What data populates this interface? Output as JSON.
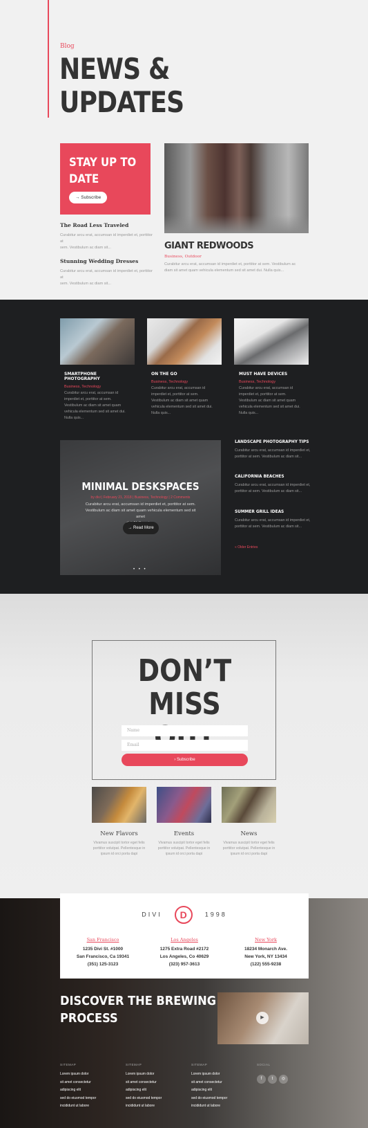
{
  "header": {
    "kicker": "Blog",
    "title_line1": "NEWS &",
    "title_line2": "UPDATES"
  },
  "subscribe_box": {
    "title_line1": "STAY UP TO",
    "title_line2": "DATE",
    "button": "→ Subscribe"
  },
  "posts_left": [
    {
      "title": "The Road Less Traveled",
      "excerpt1": "Curabitur arcu erat, accumsan id imperdiet et, porttitor at",
      "excerpt2": "sem. Vestibulum ac diam sit..."
    },
    {
      "title": "Stunning Wedding Dresses",
      "excerpt1": "Curabitur arcu erat, accumsan id imperdiet et, porttitor at",
      "excerpt2": "sem. Vestibulum ac diam sit..."
    }
  ],
  "featured": {
    "title": "GIANT REDWOODS",
    "categories": "Business, Outdoor",
    "excerpt1": "Curabitur arcu erat, accumsan id imperdiet et, porttitor at sem. Vestibulum ac",
    "excerpt2": "diam sit amet quam vehicula elementum sed sit amet dui. Nulla quis..."
  },
  "dark_posts": [
    {
      "title": "SMARTPHONE PHOTOGRAPHY",
      "categories": "Business, Technology",
      "l1": "Curabitur arcu erat, accumsan id",
      "l2": "imperdiet et, porttitor at sem.",
      "l3": "Vestibulum ac diam sit amet quam",
      "l4": "vehicula elementum sed sit amet dui.",
      "l5": "Nulla quis..."
    },
    {
      "title": "ON THE GO",
      "categories": "Business, Technology",
      "l1": "Curabitur arcu erat, accumsan id",
      "l2": "imperdiet et, porttitor at sem.",
      "l3": "Vestibulum ac diam sit amet quam",
      "l4": "vehicula elementum sed sit amet dui.",
      "l5": "Nulla quis..."
    },
    {
      "title": "MUST HAVE DEVICES",
      "categories": "Business, Technology",
      "l1": "Curabitur arcu erat, accumsan id",
      "l2": "imperdiet et, porttitor at sem.",
      "l3": "Vestibulum ac diam sit amet quam",
      "l4": "vehicula elementum sed sit amet dui.",
      "l5": "Nulla quis..."
    }
  ],
  "slider": {
    "title": "MINIMAL DESKSPACES",
    "meta": "by divi | February 21, 2018 | Business, Technology | 2 Comments",
    "l1": "Curabitur arcu erat, accumsan id imperdiet et, porttitor at sem.",
    "l2": "Vestibulum ac diam sit amet quam vehicula elementum sed sit amet",
    "l3": "dui. Nulla quis...",
    "button": "→ Read More",
    "dots": "• • •"
  },
  "side_posts": [
    {
      "title": "LANDSCAPE PHOTOGRAPHY TIPS",
      "l1": "Curabitur arcu erat, accumsan id imperdiet et,",
      "l2": "porttitor at sem. Vestibulum ac diam sit..."
    },
    {
      "title": "CALIFORNIA BEACHES",
      "l1": "Curabitur arcu erat, accumsan id imperdiet et,",
      "l2": "porttitor at sem. Vestibulum ac diam sit..."
    },
    {
      "title": "SUMMER GRILL IDEAS",
      "l1": "Curabitur arcu erat, accumsan id imperdiet et,",
      "l2": "porttitor at sem. Vestibulum ac diam sit..."
    }
  ],
  "older_entries": "« Older Entries",
  "cta": {
    "title_line1": "DON’T MISS",
    "title_line2": "OUT",
    "name_placeholder": "Name",
    "email_placeholder": "Email",
    "button": "›  Subscribe"
  },
  "features": [
    {
      "title": "New Flavors",
      "l1": "Vivamus suscipit tortor eget felis",
      "l2": "porttitor volutpat. Pellentesque in",
      "l3": "ipsum id orci porta dapi"
    },
    {
      "title": "Events",
      "l1": "Vivamus suscipit tortor eget felis",
      "l2": "porttitor volutpat. Pellentesque in",
      "l3": "ipsum id orci porta dapi"
    },
    {
      "title": "News",
      "l1": "Vivamus suscipit tortor eget felis",
      "l2": "porttitor volutpat. Pellentesque in",
      "l3": "ipsum id orci porta dapi"
    }
  ],
  "brand": {
    "left": "DIVI",
    "logo": "D",
    "right": "1998"
  },
  "addresses": [
    {
      "city": "San Francisco",
      "street": "1235 Divi St. #1000",
      "region": "San Francisco, Ca 19341",
      "phone": "(351) 125-3123"
    },
    {
      "city": "Los Angeles",
      "street": "1275 Extra Road #2172",
      "region": "Los Angeles, Co 40629",
      "phone": "(323) 957-3613"
    },
    {
      "city": "New York",
      "street": "18234 Monarch Ave.",
      "region": "New York, NY 13434",
      "phone": "(122) 555-9238"
    }
  ],
  "discover": {
    "line1": "DISCOVER THE BREWING",
    "line2": "PROCESS"
  },
  "footer_cols": [
    {
      "heading": "SITEMAP",
      "items": [
        "Lorem ipsum dolor",
        "sit amet consectetur",
        "adipiscing elit",
        "sed do eiusmod tempor",
        "incididunt ut labore"
      ]
    },
    {
      "heading": "SITEMAP",
      "items": [
        "Lorem ipsum dolor",
        "sit amet consectetur",
        "adipiscing elit",
        "sed do eiusmod tempor",
        "incididunt ut labore"
      ]
    },
    {
      "heading": "SITEMAP",
      "items": [
        "Lorem ipsum dolor",
        "sit amet consectetur",
        "adipiscing elit",
        "sed do eiusmod tempor",
        "incididunt ut labore"
      ]
    }
  ],
  "social": {
    "heading": "SOCIAL",
    "icons": [
      "f",
      "t",
      "◎"
    ]
  },
  "colors": {
    "accent": "#e8485b",
    "dark": "#1e1f21"
  }
}
